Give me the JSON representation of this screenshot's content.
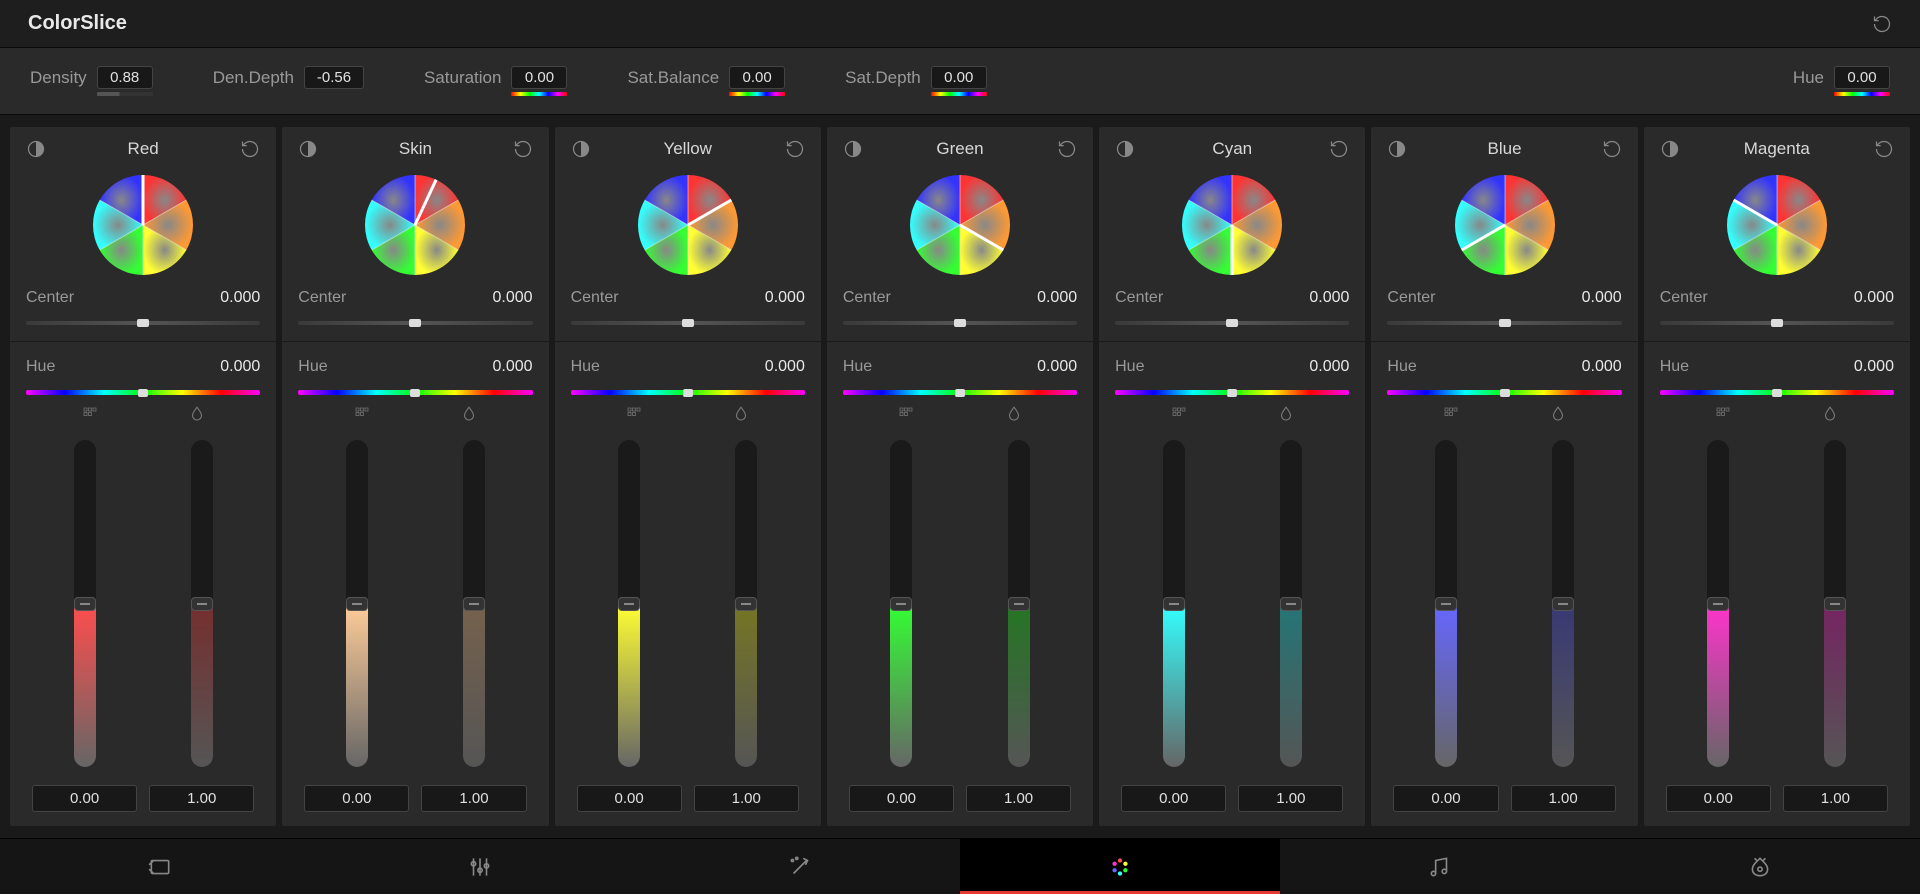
{
  "header": {
    "title": "ColorSlice"
  },
  "global": {
    "density": {
      "label": "Density",
      "value": "0.88"
    },
    "denDepth": {
      "label": "Den.Depth",
      "value": "-0.56"
    },
    "saturation": {
      "label": "Saturation",
      "value": "0.00"
    },
    "satBalance": {
      "label": "Sat.Balance",
      "value": "0.00"
    },
    "satDepth": {
      "label": "Sat.Depth",
      "value": "0.00"
    },
    "hue": {
      "label": "Hue",
      "value": "0.00"
    }
  },
  "slices": [
    {
      "name": "Red",
      "center": "0.000",
      "hue": "0.000",
      "v1": "0.00",
      "v2": "1.00",
      "tint": "#ff4d4d"
    },
    {
      "name": "Skin",
      "center": "0.000",
      "hue": "0.000",
      "v1": "0.00",
      "v2": "1.00",
      "tint": "#ffcc99"
    },
    {
      "name": "Yellow",
      "center": "0.000",
      "hue": "0.000",
      "v1": "0.00",
      "v2": "1.00",
      "tint": "#ffff33"
    },
    {
      "name": "Green",
      "center": "0.000",
      "hue": "0.000",
      "v1": "0.00",
      "v2": "1.00",
      "tint": "#33ff33"
    },
    {
      "name": "Cyan",
      "center": "0.000",
      "hue": "0.000",
      "v1": "0.00",
      "v2": "1.00",
      "tint": "#33ffff"
    },
    {
      "name": "Blue",
      "center": "0.000",
      "hue": "0.000",
      "v1": "0.00",
      "v2": "1.00",
      "tint": "#6666ff"
    },
    {
      "name": "Magenta",
      "center": "0.000",
      "hue": "0.000",
      "v1": "0.00",
      "v2": "1.00",
      "tint": "#ff33cc"
    }
  ],
  "labels": {
    "center": "Center",
    "hue": "Hue"
  }
}
